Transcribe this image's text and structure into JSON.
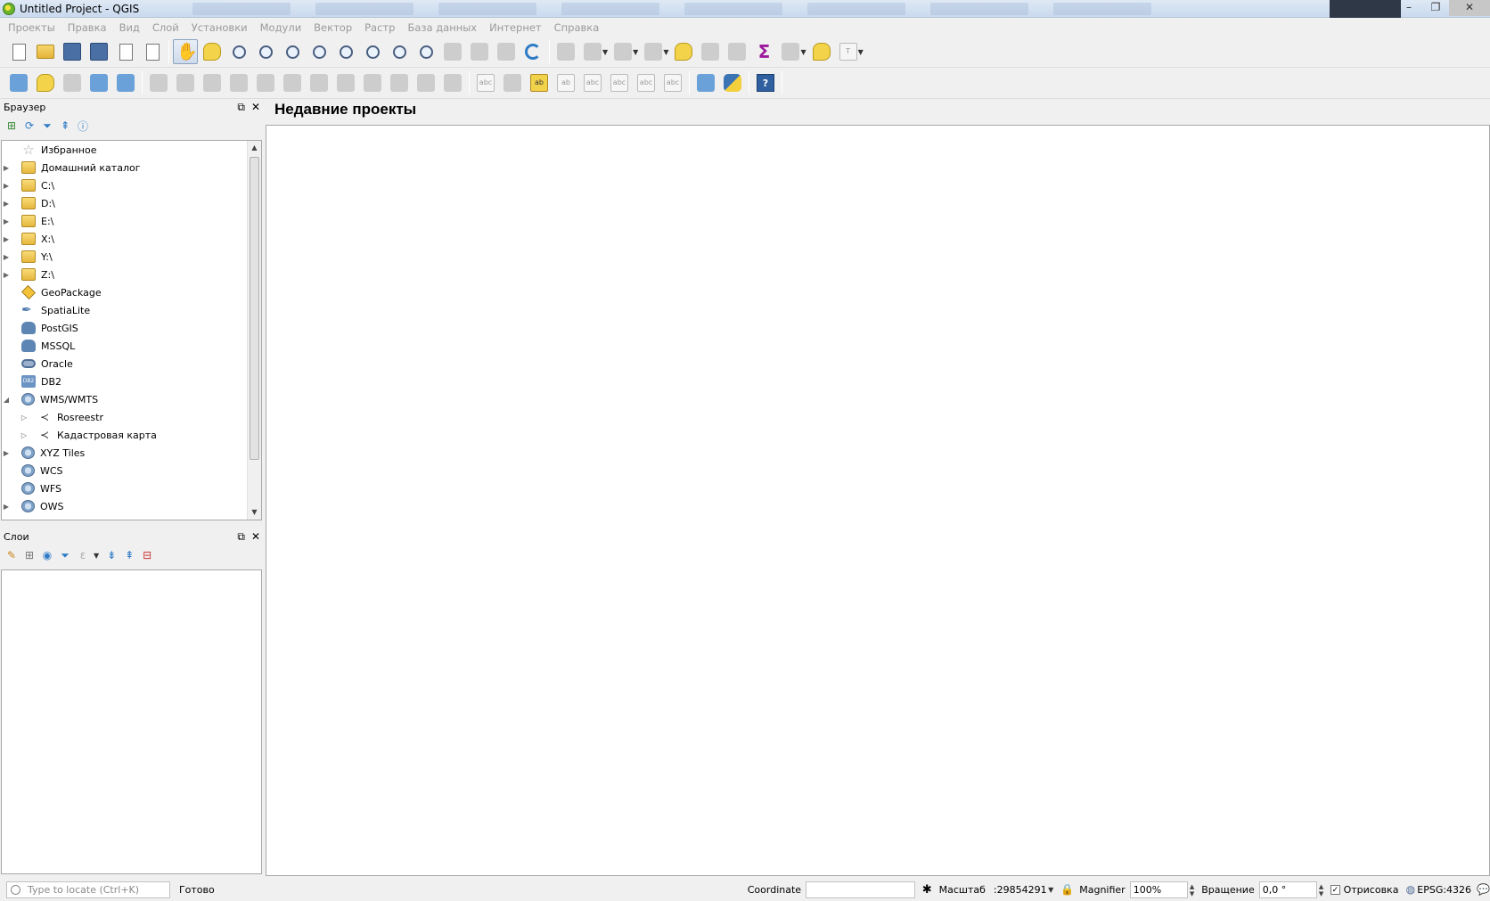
{
  "window": {
    "title": "Untitled Project - QGIS"
  },
  "menu": [
    "Проекты",
    "Правка",
    "Вид",
    "Слой",
    "Установки",
    "Модули",
    "Вектор",
    "Растр",
    "База данных",
    "Интернет",
    "Справка"
  ],
  "browser": {
    "title": "Браузер",
    "items": [
      {
        "label": "Избранное",
        "icon": "star-icon",
        "expand": ""
      },
      {
        "label": "Домашний каталог",
        "icon": "folder-icon",
        "expand": "▶"
      },
      {
        "label": "C:\\",
        "icon": "folder-icon",
        "expand": "▶"
      },
      {
        "label": "D:\\",
        "icon": "folder-icon",
        "expand": "▶"
      },
      {
        "label": "E:\\",
        "icon": "folder-icon",
        "expand": "▶"
      },
      {
        "label": "X:\\",
        "icon": "folder-icon",
        "expand": "▶"
      },
      {
        "label": "Y:\\",
        "icon": "folder-icon",
        "expand": "▶"
      },
      {
        "label": "Z:\\",
        "icon": "folder-icon",
        "expand": "▶"
      },
      {
        "label": "GeoPackage",
        "icon": "geopackage-icon",
        "expand": ""
      },
      {
        "label": "SpatiaLite",
        "icon": "spatialite-icon",
        "expand": ""
      },
      {
        "label": "PostGIS",
        "icon": "postgis-icon",
        "expand": ""
      },
      {
        "label": "MSSQL",
        "icon": "mssql-icon",
        "expand": ""
      },
      {
        "label": "Oracle",
        "icon": "oracle-icon",
        "expand": ""
      },
      {
        "label": "DB2",
        "icon": "db2-icon",
        "expand": ""
      },
      {
        "label": "WMS/WMTS",
        "icon": "globe-icon",
        "expand": "◢"
      },
      {
        "label": "Rosreestr",
        "icon": "wms-layer-icon",
        "expand": "▷",
        "child": true
      },
      {
        "label": "Кадастровая карта",
        "icon": "wms-layer-icon",
        "expand": "▷",
        "child": true
      },
      {
        "label": "XYZ Tiles",
        "icon": "globe-icon",
        "expand": "▶"
      },
      {
        "label": "WCS",
        "icon": "globe-icon",
        "expand": ""
      },
      {
        "label": "WFS",
        "icon": "globe-icon",
        "expand": ""
      },
      {
        "label": "OWS",
        "icon": "globe-icon",
        "expand": "▶"
      }
    ]
  },
  "layers": {
    "title": "Слои"
  },
  "main": {
    "heading": "Недавние проекты"
  },
  "status": {
    "locate_placeholder": "Type to locate (Ctrl+K)",
    "ready": "Готово",
    "coordinate_label": "Coordinate",
    "coordinate_value": "",
    "scale_label": "Масштаб",
    "scale_value": ":29854291",
    "magnifier_label": "Magnifier",
    "magnifier_value": "100%",
    "rotation_label": "Вращение",
    "rotation_value": "0,0 °",
    "render_label": "Отрисовка",
    "crs": "EPSG:4326"
  }
}
